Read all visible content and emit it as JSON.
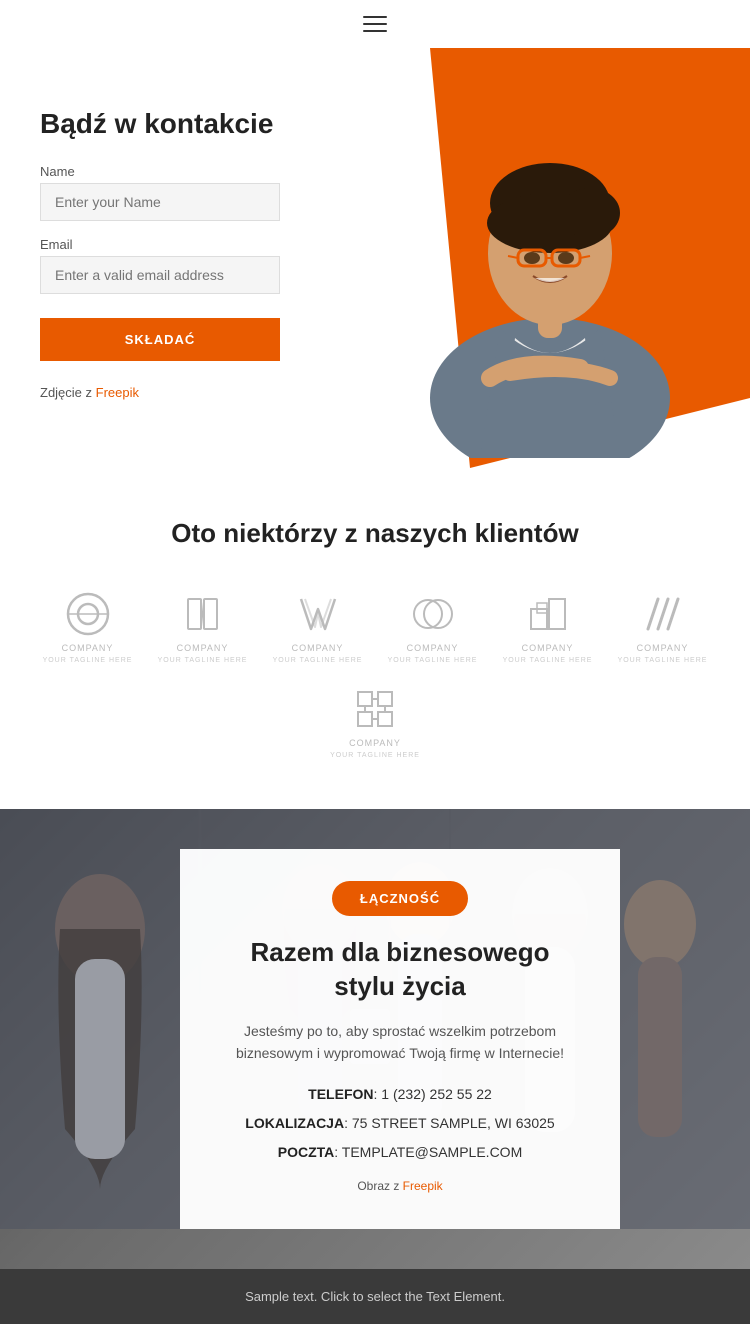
{
  "navbar": {
    "menu_icon": "hamburger-icon"
  },
  "hero": {
    "title": "Bądź w kontakcie",
    "name_label": "Name",
    "name_placeholder": "Enter your Name",
    "email_label": "Email",
    "email_placeholder": "Enter a valid email address",
    "submit_label": "SKŁADAĆ",
    "photo_credit_prefix": "Zdjęcie z ",
    "photo_credit_link": "Freepik"
  },
  "clients": {
    "title": "Oto niektórzy z naszych klientów",
    "logos": [
      {
        "id": 1,
        "name": "COMPANY",
        "tagline": "YOUR TAGLINE HERE"
      },
      {
        "id": 2,
        "name": "COMPANY",
        "tagline": "YOUR TAGLINE HERE"
      },
      {
        "id": 3,
        "name": "COMPANY",
        "tagline": "YOUR TAGLINE HERE"
      },
      {
        "id": 4,
        "name": "COMPANY",
        "tagline": "YOUR TAGLINE HERE"
      },
      {
        "id": 5,
        "name": "COMPANY",
        "tagline": "YOUR TAGLINE HERE"
      },
      {
        "id": 6,
        "name": "COMPANY",
        "tagline": "YOUR TAGLINE HERE"
      },
      {
        "id": 7,
        "name": "COMPANY",
        "tagline": "YOUR TAGLINE HERE"
      }
    ]
  },
  "contact": {
    "badge": "ŁĄCZNOŚĆ",
    "title": "Razem dla biznesowego stylu życia",
    "description": "Jesteśmy po to, aby sprostać wszelkim potrzebom biznesowym i wypromować Twoją firmę w Internecie!",
    "phone_label": "TELEFON",
    "phone_value": "1 (232) 252 55 22",
    "location_label": "LOKALIZACJA",
    "location_value": "75 STREET SAMPLE, WI 63025",
    "email_label": "POCZTA",
    "email_value": "TEMPLATE@SAMPLE.COM",
    "photo_credit_prefix": "Obraz z ",
    "photo_credit_link": "Freepik"
  },
  "footer": {
    "text": "Sample text. Click to select the Text Element."
  },
  "colors": {
    "orange": "#e85a00",
    "dark": "#222222",
    "gray": "#555555",
    "light_bg": "#f5f5f5"
  }
}
